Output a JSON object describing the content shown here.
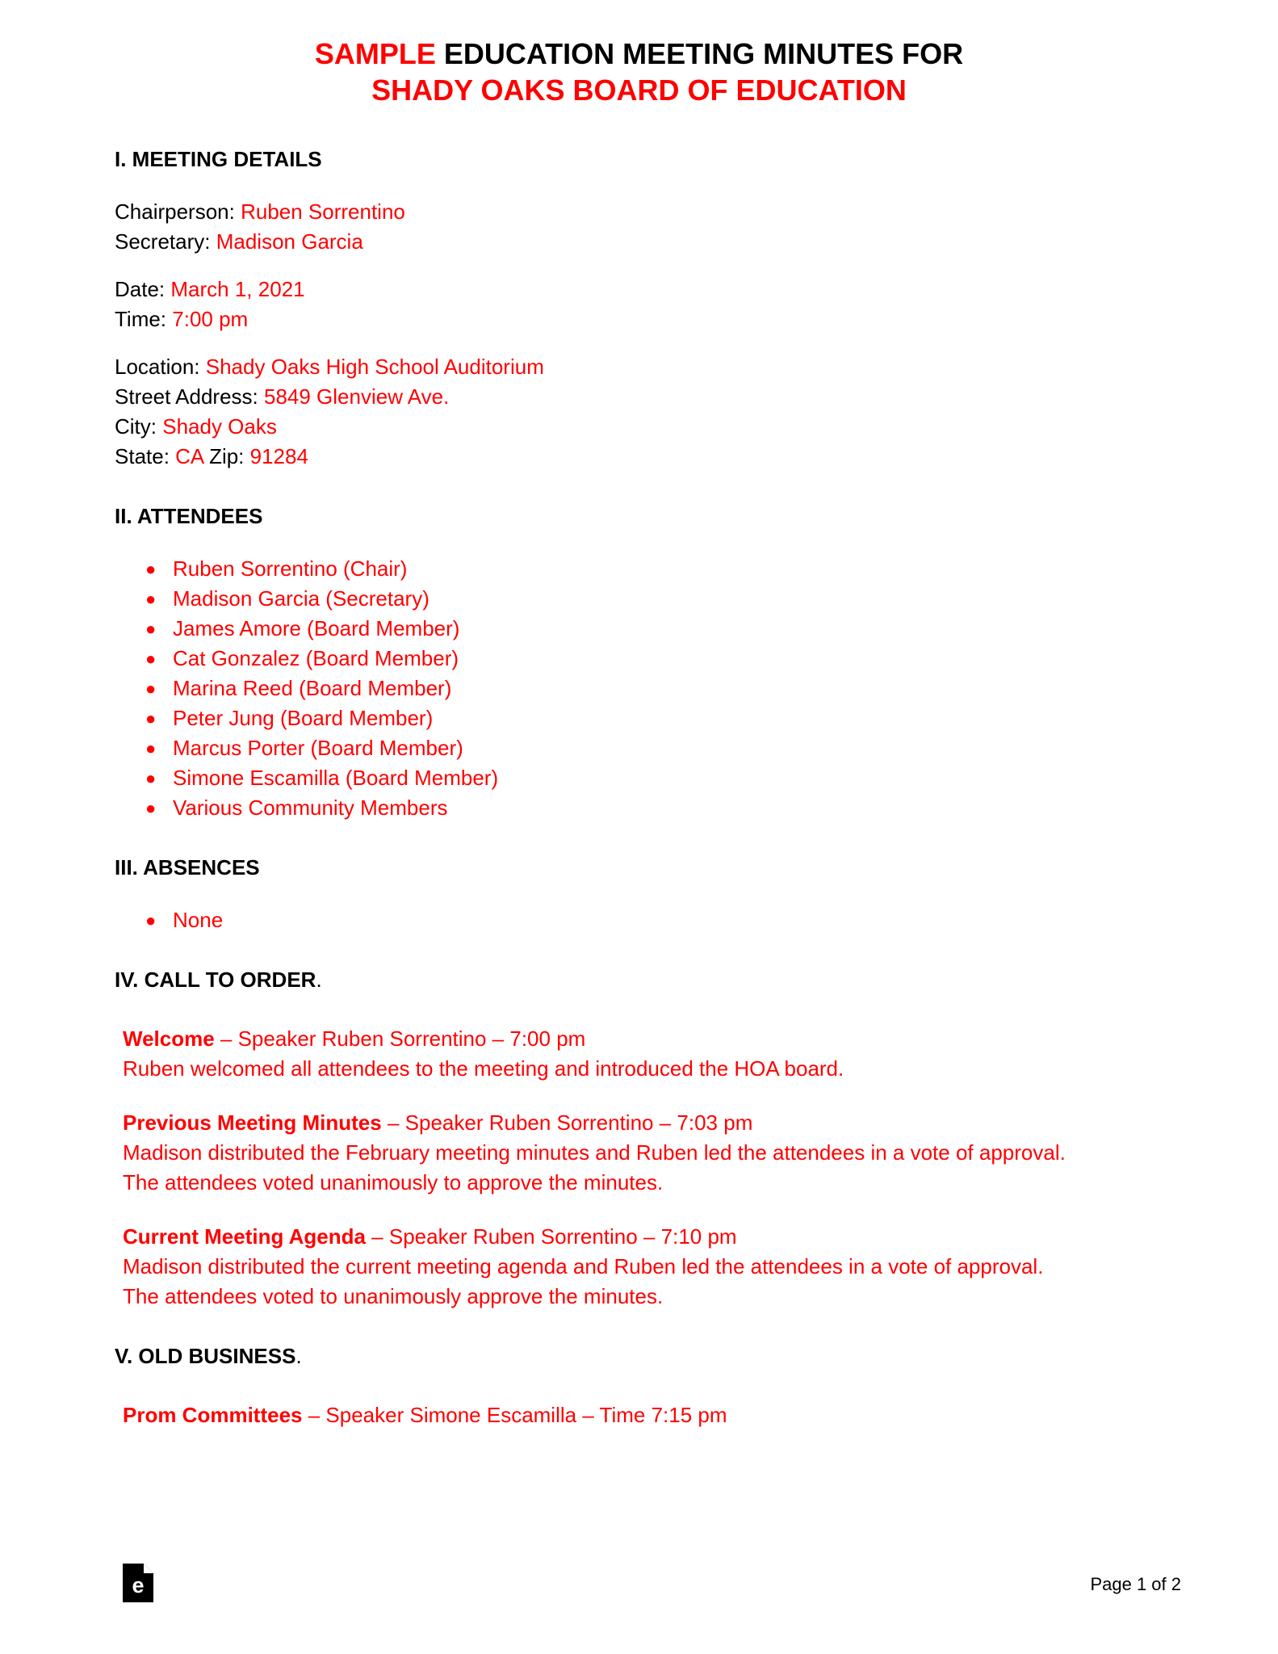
{
  "document": {
    "title_line1_highlight": "SAMPLE",
    "title_line1_rest": " EDUCATION MEETING MINUTES FOR",
    "title_line2": "SHADY OAKS BOARD OF EDUCATION",
    "accent_color": "#FF0000",
    "text_color": "#000000",
    "background_color": "#FFFFFF"
  },
  "sections": {
    "meeting_details": {
      "heading": "I. MEETING DETAILS",
      "people": [
        {
          "label": "Chairperson: ",
          "value": "Ruben Sorrentino"
        },
        {
          "label": "Secretary: ",
          "value": "Madison Garcia"
        }
      ],
      "when": [
        {
          "label": "Date: ",
          "value": "March 1, 2021"
        },
        {
          "label": "Time: ",
          "value": "7:00 pm"
        }
      ],
      "place": [
        {
          "label": "Location: ",
          "value": "Shady Oaks High School Auditorium"
        },
        {
          "label": "Street Address: ",
          "value": "5849 Glenview Ave."
        },
        {
          "label": "City: ",
          "value": "Shady Oaks"
        }
      ],
      "state_line": {
        "state_label": "State: ",
        "state_value": "CA",
        "zip_label": " Zip: ",
        "zip_value": "91284"
      }
    },
    "attendees": {
      "heading": "II. ATTENDEES",
      "items": [
        "Ruben Sorrentino (Chair)",
        "Madison Garcia (Secretary)",
        "James Amore (Board Member)",
        "Cat Gonzalez (Board Member)",
        "Marina Reed (Board Member)",
        "Peter Jung (Board Member)",
        "Marcus Porter (Board Member)",
        "Simone Escamilla (Board Member)",
        "Various Community Members"
      ]
    },
    "absences": {
      "heading": "III. ABSENCES",
      "items": [
        "None"
      ]
    },
    "call_to_order": {
      "heading": "IV. CALL TO ORDER",
      "heading_suffix": ".",
      "items": [
        {
          "head": "Welcome",
          "head_rest": " – Speaker Ruben Sorrentino – 7:00 pm",
          "body": "Ruben welcomed all attendees to the meeting and introduced the HOA board."
        },
        {
          "head": "Previous Meeting Minutes",
          "head_rest": " – Speaker Ruben Sorrentino – 7:03 pm",
          "body": "Madison distributed the February meeting minutes and Ruben led the attendees in a vote of approval. The attendees voted unanimously to approve the minutes."
        },
        {
          "head": "Current Meeting Agenda",
          "head_rest": " – Speaker Ruben Sorrentino – 7:10 pm",
          "body": "Madison distributed the current meeting agenda and Ruben led the attendees in a vote of approval. The attendees voted to unanimously approve the minutes."
        }
      ]
    },
    "old_business": {
      "heading": "V. OLD BUSINESS",
      "heading_suffix": ".",
      "items": [
        {
          "head": "Prom Committees",
          "head_rest": " – Speaker Simone Escamilla – Time 7:15 pm",
          "body": ""
        }
      ]
    }
  },
  "footer": {
    "logo_name": "eforms-document-logo",
    "logo_letter": "e",
    "page_number": "Page 1 of 2"
  }
}
